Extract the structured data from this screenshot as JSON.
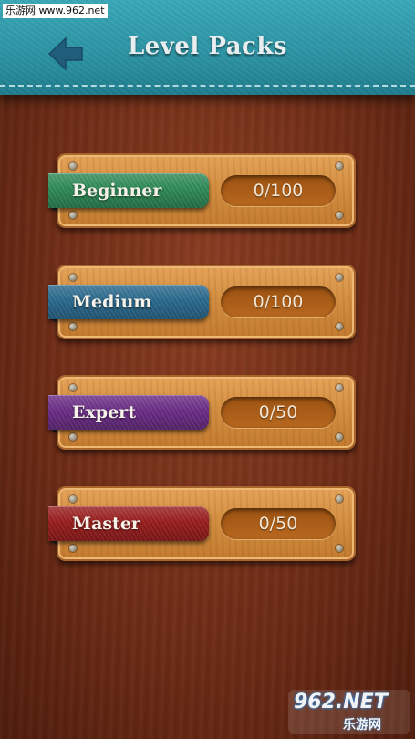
{
  "watermark": {
    "top": "乐游网 www.962.net",
    "badge_main": "962.NET",
    "badge_sub": "乐游网"
  },
  "header": {
    "title": "Level Packs",
    "back_icon": "arrow-left-icon",
    "color": "#2c93a3"
  },
  "packs": [
    {
      "name": "Beginner",
      "progress": "0/100",
      "color": "#2e8a57"
    },
    {
      "name": "Medium",
      "progress": "0/100",
      "color": "#2a6a8e"
    },
    {
      "name": "Expert",
      "progress": "0/50",
      "color": "#6b2c86"
    },
    {
      "name": "Master",
      "progress": "0/50",
      "color": "#9a1d1d"
    }
  ]
}
